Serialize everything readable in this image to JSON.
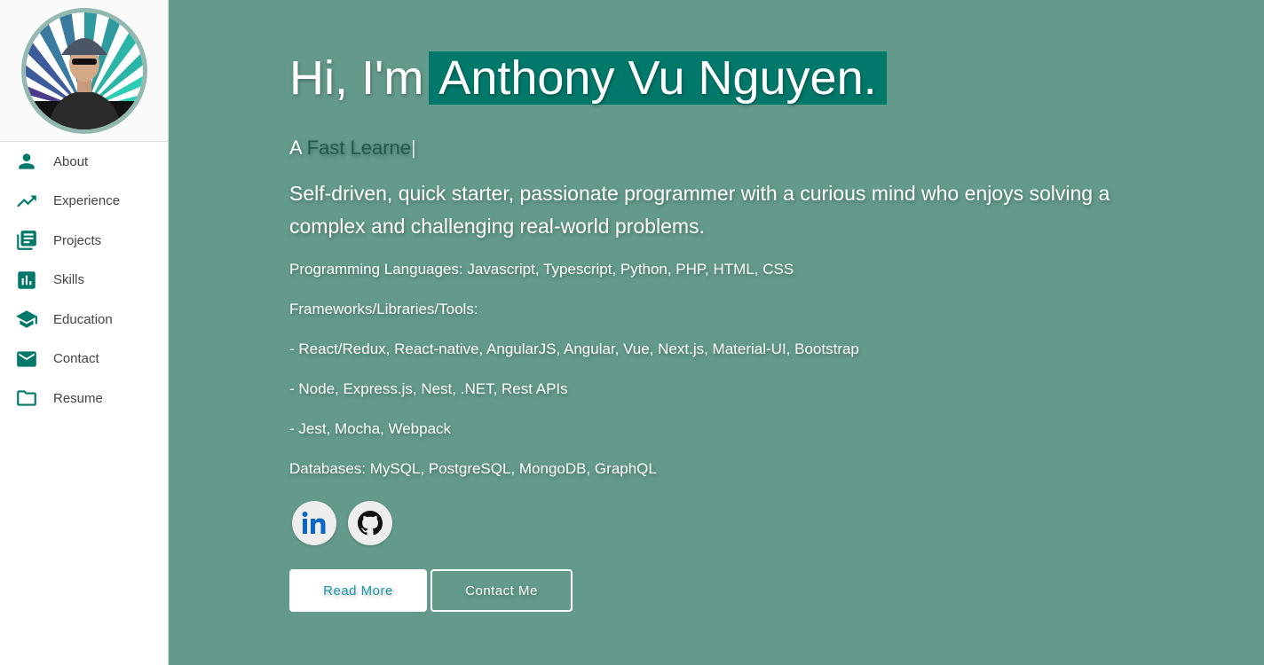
{
  "sidebar": {
    "items": [
      {
        "label": "About",
        "icon": "person-icon"
      },
      {
        "label": "Experience",
        "icon": "trending-up-icon"
      },
      {
        "label": "Projects",
        "icon": "library-books-icon"
      },
      {
        "label": "Skills",
        "icon": "bar-chart-icon"
      },
      {
        "label": "Education",
        "icon": "school-icon"
      },
      {
        "label": "Contact",
        "icon": "mail-icon"
      },
      {
        "label": "Resume",
        "icon": "folder-icon"
      }
    ]
  },
  "hero": {
    "greeting": "Hi, I'm",
    "name": "Anthony Vu Nguyen.",
    "typed_prefix": "A",
    "typed_text": "Fast Learne",
    "cursor": "|",
    "summary": "Self-driven, quick starter, passionate programmer with a curious mind who enjoys solving a complex and challenging real-world problems.",
    "lines": [
      "Programming Languages: Javascript, Typescript, Python, PHP, HTML, CSS",
      "Frameworks/Libraries/Tools:",
      "- React/Redux, React-native, AngularJS, Angular, Vue, Next.js, Material-UI, Bootstrap",
      "- Node, Express.js, Nest, .NET, Rest APIs",
      "- Jest, Mocha, Webpack",
      "Databases: MySQL, PostgreSQL, MongoDB, GraphQL"
    ],
    "read_more": "Read More",
    "contact_me": "Contact Me"
  },
  "colors": {
    "background": "#639a8c",
    "accent": "#00796b",
    "button_text": "#1b9aaa"
  }
}
